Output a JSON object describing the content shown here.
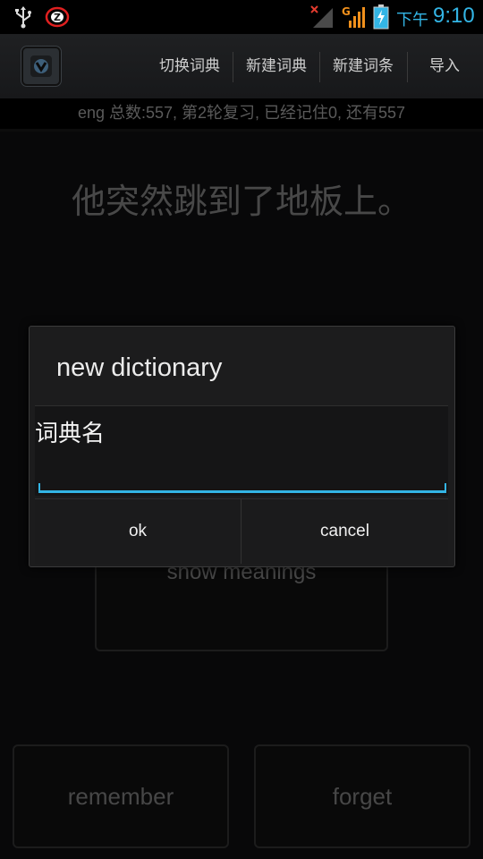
{
  "status_bar": {
    "time_prefix": "下午",
    "time": "9:10",
    "network_label": "G",
    "icons": [
      "usb-icon",
      "z-notification-icon",
      "signal-no-service-icon",
      "signal-g-icon",
      "battery-charging-icon"
    ]
  },
  "action_bar": {
    "app_icon": "app-logo-icon",
    "items": [
      {
        "label": "切换词典"
      },
      {
        "label": "新建词典"
      },
      {
        "label": "新建词条"
      },
      {
        "label": "导入"
      }
    ]
  },
  "stats": {
    "text": "eng 总数:557, 第2轮复习, 已经记住0, 还有557"
  },
  "card": {
    "sentence": "他突然跳到了地板上。",
    "show_meanings_label": "show meanings",
    "remember_label": "remember",
    "forget_label": "forget"
  },
  "dialog": {
    "title": "new dictionary",
    "field_label": "词典名",
    "field_value": "",
    "ok_label": "ok",
    "cancel_label": "cancel"
  },
  "colors": {
    "accent": "#33b5e5",
    "background": "#0d0d0e"
  }
}
